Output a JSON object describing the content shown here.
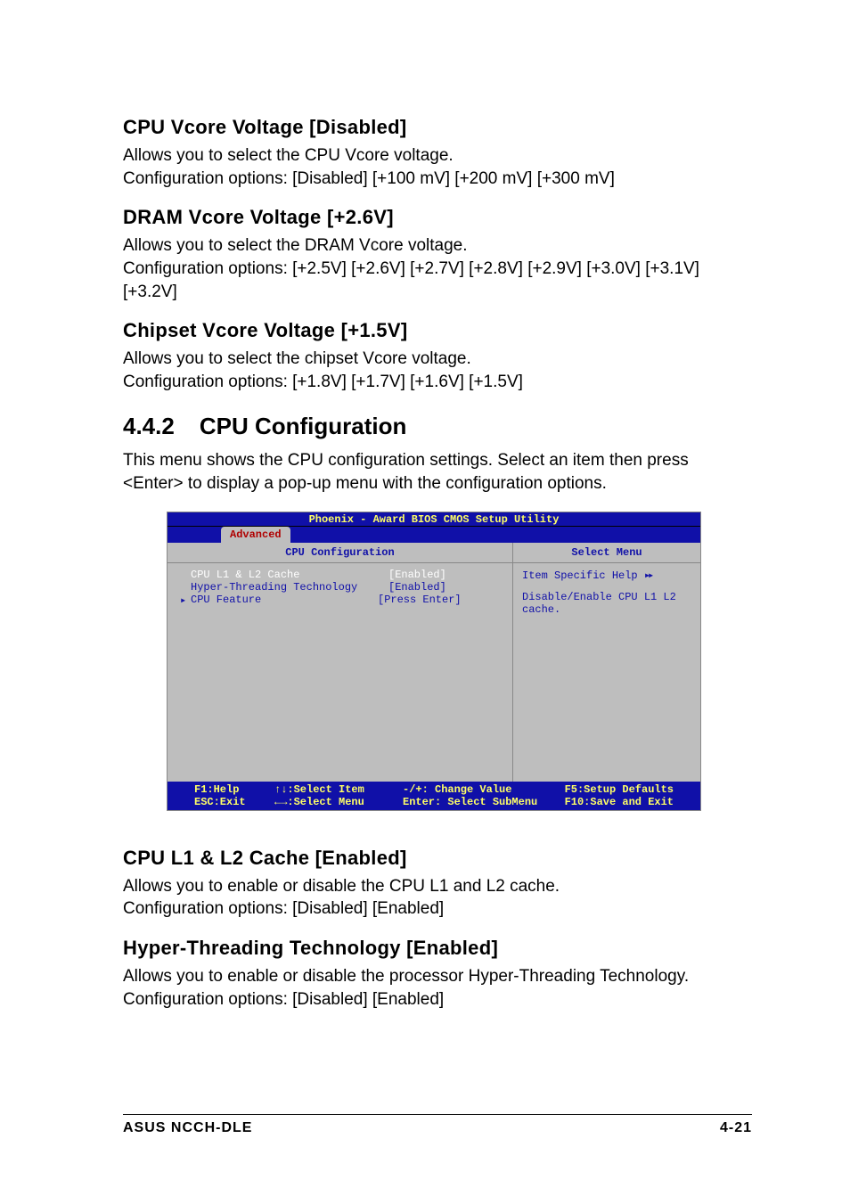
{
  "sections": {
    "s1": {
      "heading": "CPU Vcore Voltage [Disabled]",
      "p1": "Allows you to select the CPU Vcore voltage.",
      "p2": "Configuration options: [Disabled] [+100 mV] [+200 mV] [+300 mV]"
    },
    "s2": {
      "heading": "DRAM Vcore Voltage [+2.6V]",
      "p1": "Allows you to select the DRAM Vcore voltage.",
      "p2": "Configuration options: [+2.5V] [+2.6V] [+2.7V] [+2.8V] [+2.9V] [+3.0V] [+3.1V] [+3.2V]"
    },
    "s3": {
      "heading": "Chipset Vcore Voltage [+1.5V]",
      "p1": "Allows you to select the chipset Vcore voltage.",
      "p2": "Configuration options: [+1.8V] [+1.7V] [+1.6V] [+1.5V]"
    },
    "h442_num": "4.4.2",
    "h442_title": "CPU Configuration",
    "h442_desc": "This menu shows the CPU configuration settings. Select an item then press <Enter> to display a pop-up menu with the configuration options.",
    "s4": {
      "heading": "CPU L1 & L2 Cache [Enabled]",
      "p1": "Allows you to enable or disable the CPU L1 and L2 cache.",
      "p2": "Configuration options: [Disabled] [Enabled]"
    },
    "s5": {
      "heading": "Hyper-Threading Technology [Enabled]",
      "p1": "Allows you to enable or disable the processor Hyper-Threading Technology.",
      "p2": "Configuration options: [Disabled] [Enabled]"
    }
  },
  "bios": {
    "title": "Phoenix - Award BIOS CMOS Setup Utility",
    "tab": "Advanced",
    "left_header": "CPU Configuration",
    "right_header": "Select Menu",
    "rows": [
      {
        "label": "CPU L1 & L2 Cache",
        "value": "[Enabled]",
        "selected": true,
        "submenu": false
      },
      {
        "label": "Hyper-Threading Technology",
        "value": "[Enabled]",
        "selected": false,
        "submenu": false
      },
      {
        "label": "CPU Feature",
        "value": "[Press Enter]",
        "selected": false,
        "submenu": true
      }
    ],
    "help_title": "Item Specific Help",
    "help_body": "Disable/Enable CPU L1 L2 cache.",
    "footer": {
      "c1a": "F1:Help",
      "c1b": "ESC:Exit",
      "c2a": "↑↓:Select Item",
      "c2b": "←→:Select Menu",
      "c3a": "-/+: Change Value",
      "c3b": "Enter: Select SubMenu",
      "c4a": "F5:Setup Defaults",
      "c4b": "F10:Save and Exit"
    }
  },
  "footer": {
    "left": "ASUS NCCH-DLE",
    "right": "4-21"
  }
}
